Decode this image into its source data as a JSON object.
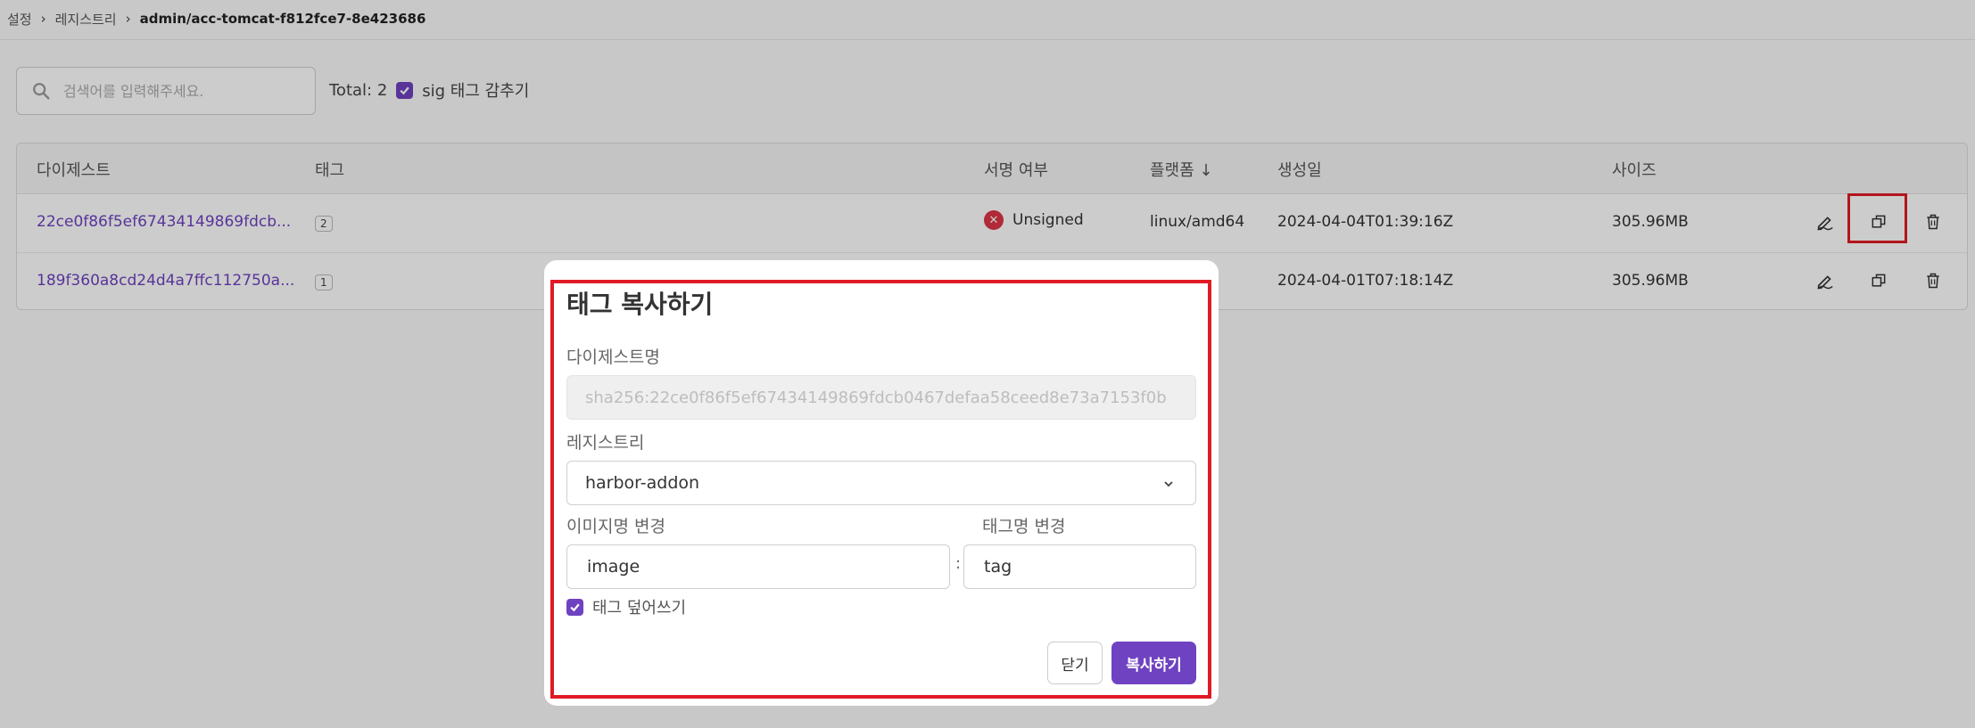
{
  "breadcrumb": {
    "items": [
      "설정",
      "레지스트리",
      "admin/acc-tomcat-f812fce7-8e423686"
    ]
  },
  "search": {
    "placeholder": "검색어를 입력해주세요."
  },
  "filter": {
    "total_label": "Total: 2",
    "hide_sig_label": "sig 태그 감추기",
    "hide_sig_checked": true
  },
  "table": {
    "headers": [
      "다이제스트",
      "태그",
      "서명 여부",
      "플랫폼",
      "생성일",
      "사이즈"
    ],
    "rows": [
      {
        "digest": "22ce0f86f5ef67434149869fdcb...",
        "tag_count": "2",
        "signature": "Unsigned",
        "platform": "linux/amd64",
        "created": "2024-04-04T01:39:16Z",
        "size": "305.96MB"
      },
      {
        "digest": "189f360a8cd24d4a7ffc112750a...",
        "tag_count": "1",
        "signature": "",
        "platform": "d64",
        "created": "2024-04-01T07:18:14Z",
        "size": "305.96MB"
      }
    ]
  },
  "modal": {
    "title": "태그 복사하기",
    "digest_label": "다이제스트명",
    "digest_value": "sha256:22ce0f86f5ef67434149869fdcb0467defaa58ceed8e73a7153f0b",
    "registry_label": "레지스트리",
    "registry_value": "harbor-addon",
    "image_label": "이미지명 변경",
    "image_value": "image",
    "tag_label": "태그명 변경",
    "tag_value": "tag",
    "separator": ":",
    "overwrite_label": "태그 덮어쓰기",
    "overwrite_checked": true,
    "close_label": "닫기",
    "copy_label": "복사하기"
  },
  "colors": {
    "accent": "#6f42c1",
    "highlight": "#e01b24",
    "error": "#dc3545"
  }
}
